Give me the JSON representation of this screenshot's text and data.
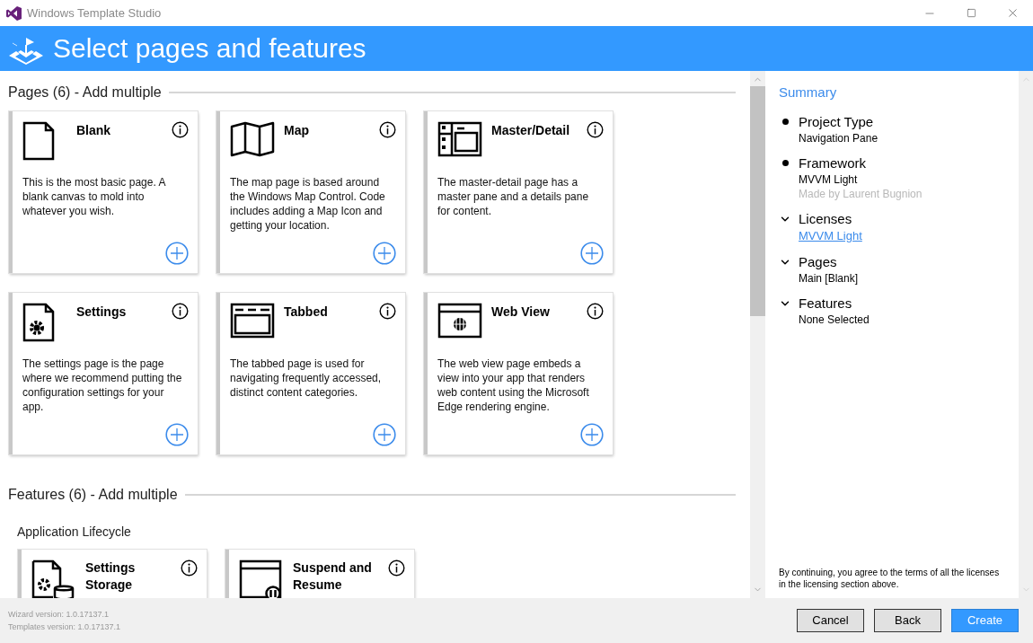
{
  "window": {
    "title": "Windows Template Studio"
  },
  "header": {
    "title": "Select pages and features"
  },
  "pages_section": {
    "title": "Pages (6) - Add multiple",
    "cards": [
      {
        "kind": "blank",
        "title": "Blank",
        "description": "This is the most basic page. A blank canvas to mold into whatever you wish."
      },
      {
        "kind": "map",
        "title": "Map",
        "description": "The map page is based around the Windows Map Control. Code includes adding a Map Icon and getting your location."
      },
      {
        "kind": "master",
        "title": "Master/Detail",
        "description": "The master-detail page has a master pane and a details pane for content."
      },
      {
        "kind": "settings",
        "title": "Settings",
        "description": "The settings page is the page where we recommend putting the configuration settings for your app."
      },
      {
        "kind": "tabbed",
        "title": "Tabbed",
        "description": "The tabbed page is used for navigating frequently accessed, distinct content categories."
      },
      {
        "kind": "web",
        "title": "Web View",
        "description": "The web view page embeds a view into your app that renders web content using the Microsoft Edge rendering engine."
      }
    ]
  },
  "features_section": {
    "title": "Features (6) - Add multiple",
    "group": "Application Lifecycle",
    "cards": [
      {
        "kind": "storage",
        "title": "Settings Storage"
      },
      {
        "kind": "suspend",
        "title": "Suspend and Resume"
      }
    ]
  },
  "summary": {
    "title": "Summary",
    "items": [
      {
        "kind": "bullet",
        "label": "Project Type",
        "lines": [
          {
            "kind": "text",
            "text": "Navigation Pane"
          }
        ]
      },
      {
        "kind": "bullet",
        "label": "Framework",
        "lines": [
          {
            "kind": "text",
            "text": "MVVM Light"
          },
          {
            "kind": "muted",
            "text": "Made by Laurent Bugnion"
          }
        ]
      },
      {
        "kind": "expander",
        "expanded": true,
        "label": "Licenses",
        "lines": [
          {
            "kind": "link",
            "text": "MVVM Light"
          }
        ]
      },
      {
        "kind": "expander",
        "expanded": true,
        "label": "Pages",
        "lines": [
          {
            "kind": "text",
            "text": "Main [Blank]"
          }
        ]
      },
      {
        "kind": "expander",
        "expanded": true,
        "label": "Features",
        "lines": [
          {
            "kind": "text",
            "text": "None Selected"
          }
        ]
      }
    ],
    "notice": "By continuing, you agree to the terms of all the licenses in the licensing section above."
  },
  "footer": {
    "versions": [
      "Wizard version: 1.0.17137.1",
      "Templates version: 1.0.17137.1"
    ],
    "buttons": [
      {
        "kind": "normal",
        "label": "Cancel"
      },
      {
        "kind": "normal",
        "label": "Back"
      },
      {
        "kind": "primary",
        "label": "Create"
      }
    ]
  }
}
